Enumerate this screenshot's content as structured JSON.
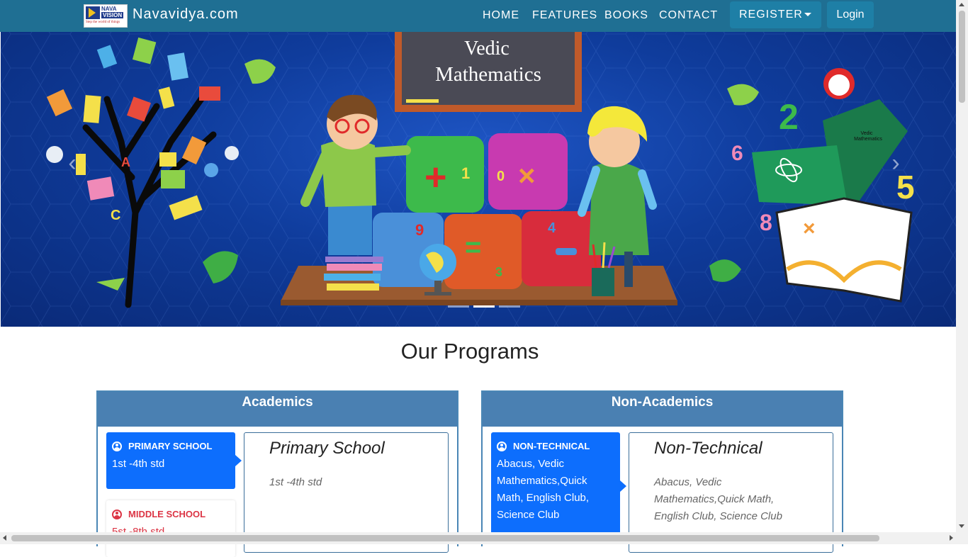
{
  "navbar": {
    "logo_text_top": "NAVA",
    "logo_text_bottom": "VISION",
    "logo_tagline": "Step the world of things",
    "brand": "Navavidya.com",
    "links": [
      "HOME",
      "FEATURES",
      "BOOKS",
      "CONTACT"
    ],
    "register_label": "REGISTER",
    "login_label": "Login",
    "color": "#1f6f93"
  },
  "hero": {
    "board_line1": "Vedic",
    "board_line2": "Mathematics",
    "book_title": "Vedic Mathematics",
    "prev_icon": "chevron-left-icon",
    "next_icon": "chevron-right-icon",
    "slide_count": 3,
    "active_slide": 2
  },
  "programs": {
    "title": "Our Programs",
    "academics": {
      "heading": "Academics",
      "tabs": [
        {
          "title": "PRIMARY SCHOOL",
          "desc": "1st -4th std",
          "active": true
        },
        {
          "title": "MIDDLE SCHOOL",
          "desc": "5st -8th std",
          "active": false
        }
      ],
      "panel_title": "Primary School",
      "panel_desc": "1st -4th std"
    },
    "non_academics": {
      "heading": "Non-Academics",
      "tabs": [
        {
          "title": "NON-TECHNICAL",
          "desc": "Abacus, Vedic Mathematics,Quick Math, English Club, Science Club",
          "active": true
        }
      ],
      "panel_title": "Non-Technical",
      "panel_desc": "Abacus, Vedic Mathematics,Quick Math, English Club, Science Club"
    }
  },
  "colors": {
    "accent": "#0d6efd",
    "card_header": "#4a80b2",
    "inactive_text": "#dc3545"
  }
}
